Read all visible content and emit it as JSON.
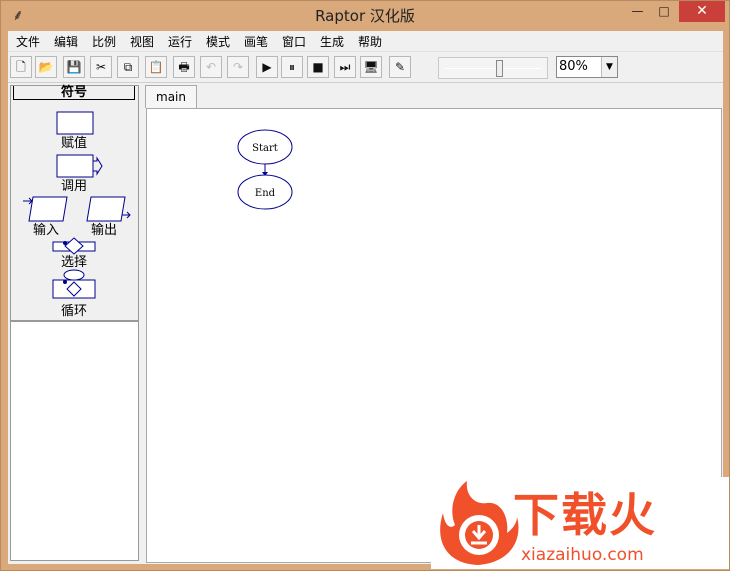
{
  "window": {
    "title": "Raptor 汉化版",
    "min_label": "—",
    "max_label": "□",
    "close_label": "✕"
  },
  "menu": [
    "文件",
    "编辑",
    "比例",
    "视图",
    "运行",
    "模式",
    "画笔",
    "窗口",
    "生成",
    "帮助"
  ],
  "toolbar": {
    "buttons": [
      {
        "name": "new-file-icon",
        "glyph": "🗋",
        "enabled": true
      },
      {
        "name": "open-folder-icon",
        "glyph": "📂",
        "enabled": true
      },
      {
        "name": "save-icon",
        "glyph": "💾",
        "enabled": true
      },
      {
        "name": "cut-icon",
        "glyph": "✂",
        "enabled": true
      },
      {
        "name": "copy-icon",
        "glyph": "⧉",
        "enabled": true
      },
      {
        "name": "paste-icon",
        "glyph": "📋",
        "enabled": true
      },
      {
        "name": "print-icon",
        "glyph": "🖶",
        "enabled": true
      },
      {
        "name": "undo-icon",
        "glyph": "↶",
        "enabled": false
      },
      {
        "name": "redo-icon",
        "glyph": "↷",
        "enabled": false
      },
      {
        "name": "run-icon",
        "glyph": "▶",
        "enabled": true
      },
      {
        "name": "pause-icon",
        "glyph": "⏸",
        "enabled": true
      },
      {
        "name": "stop-icon",
        "glyph": "■",
        "enabled": true
      },
      {
        "name": "step-icon",
        "glyph": "⏭",
        "enabled": true
      },
      {
        "name": "test-server-icon",
        "glyph": "🖥",
        "enabled": true
      },
      {
        "name": "pen-icon",
        "glyph": "✎",
        "enabled": true
      }
    ],
    "speed_slider_value": 0.55,
    "zoom": "80%"
  },
  "symbols": {
    "title": "符号",
    "assign": "赋值",
    "call": "调用",
    "input": "输入",
    "output": "输出",
    "selection": "选择",
    "loop": "循环"
  },
  "tabs": [
    "main"
  ],
  "flowchart": {
    "start": "Start",
    "end": "End"
  },
  "watermark": {
    "cn": "下载火",
    "en": "xiazaihuo.com",
    "color": "#f0502a"
  }
}
